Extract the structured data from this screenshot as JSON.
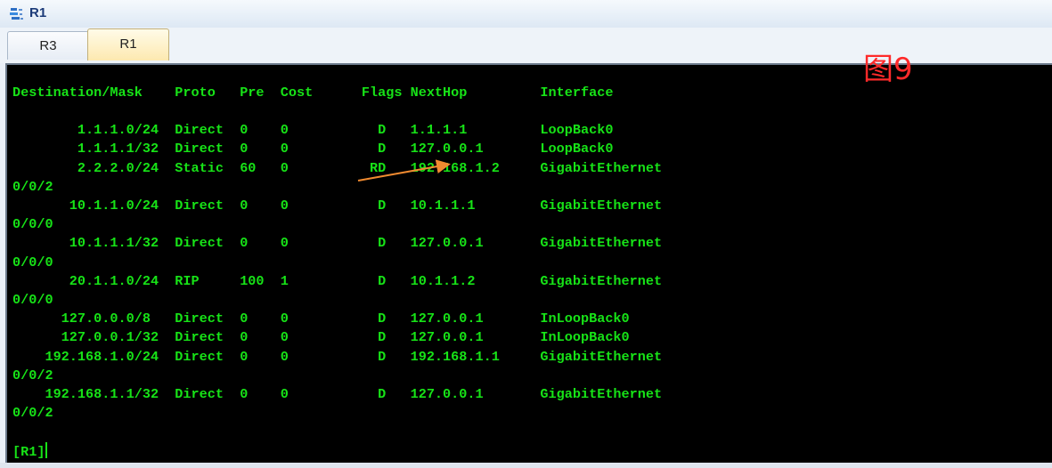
{
  "window": {
    "title": "R1"
  },
  "tabs": [
    {
      "label": "R3",
      "active": false
    },
    {
      "label": "R1",
      "active": true
    }
  ],
  "terminal": {
    "header": "Destination/Mask    Proto   Pre  Cost      Flags NextHop         Interface",
    "lines": [
      "",
      "        1.1.1.0/24  Direct  0    0           D   1.1.1.1         LoopBack0",
      "        1.1.1.1/32  Direct  0    0           D   127.0.0.1       LoopBack0",
      "        2.2.2.0/24  Static  60   0          RD   192.168.1.2     GigabitEthernet",
      "0/0/2",
      "       10.1.1.0/24  Direct  0    0           D   10.1.1.1        GigabitEthernet",
      "0/0/0",
      "       10.1.1.1/32  Direct  0    0           D   127.0.0.1       GigabitEthernet",
      "0/0/0",
      "       20.1.1.0/24  RIP     100  1           D   10.1.1.2        GigabitEthernet",
      "0/0/0",
      "      127.0.0.0/8   Direct  0    0           D   127.0.0.1       InLoopBack0",
      "      127.0.0.1/32  Direct  0    0           D   127.0.0.1       InLoopBack0",
      "    192.168.1.0/24  Direct  0    0           D   192.168.1.1     GigabitEthernet",
      "0/0/2",
      "    192.168.1.1/32  Direct  0    0           D   127.0.0.1       GigabitEthernet",
      "0/0/2",
      ""
    ],
    "prompt": "[R1]",
    "text_color": "#17e317",
    "background": "#000000"
  },
  "annotation": {
    "label": "图9",
    "color": "#ff2a2a",
    "arrow_color": "#f08a30"
  },
  "icons": {
    "title": "network-device-icon"
  }
}
